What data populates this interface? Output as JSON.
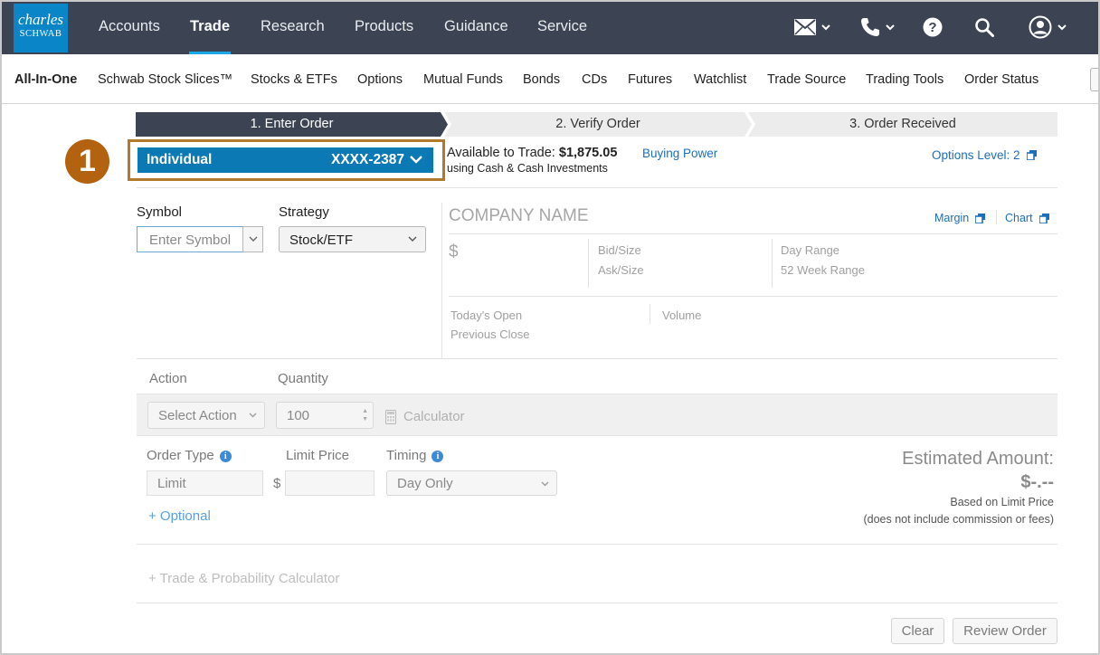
{
  "brand": {
    "logo_line1": "charles",
    "logo_line2": "SCHWAB",
    "logo_color": "#0a86c8"
  },
  "topnav": {
    "items": [
      {
        "label": "Accounts"
      },
      {
        "label": "Trade",
        "active": true
      },
      {
        "label": "Research"
      },
      {
        "label": "Products"
      },
      {
        "label": "Guidance"
      },
      {
        "label": "Service"
      }
    ],
    "icons": [
      "mail-icon",
      "phone-icon",
      "help-icon",
      "search-icon",
      "user-icon"
    ],
    "background": "#3c4453",
    "active_underline": "#19a9e8"
  },
  "subnav": {
    "items": [
      {
        "label": "All-In-One",
        "active": true
      },
      {
        "label": "Schwab Stock Slices™"
      },
      {
        "label": "Stocks & ETFs"
      },
      {
        "label": "Options"
      },
      {
        "label": "Mutual Funds"
      },
      {
        "label": "Bonds"
      },
      {
        "label": "CDs"
      },
      {
        "label": "Futures"
      },
      {
        "label": "Watchlist"
      },
      {
        "label": "Trade Source"
      },
      {
        "label": "Trading Tools"
      },
      {
        "label": "Order Status"
      }
    ]
  },
  "steps": [
    {
      "label": "1. Enter Order",
      "active": true
    },
    {
      "label": "2. Verify Order"
    },
    {
      "label": "3. Order Received"
    }
  ],
  "callout": {
    "number": "1",
    "color": "#b3620f"
  },
  "account": {
    "name": "Individual",
    "number": "XXXX-2387",
    "available_label": "Available to Trade:",
    "available_value": "$1,875.05",
    "available_sub": "using Cash & Cash Investments",
    "buying_power": "Buying Power",
    "options_level": "Options Level: 2"
  },
  "order_entry": {
    "symbol_label": "Symbol",
    "symbol_placeholder": "Enter Symbol",
    "strategy_label": "Strategy",
    "strategy_value": "Stock/ETF"
  },
  "quote": {
    "company": "COMPANY NAME",
    "margin_link": "Margin",
    "chart_link": "Chart",
    "price": "$",
    "bid_size": "Bid/Size",
    "ask_size": "Ask/Size",
    "day_range": "Day Range",
    "week52_range": "52 Week Range",
    "todays_open": "Today's Open",
    "previous_close": "Previous Close",
    "volume": "Volume"
  },
  "action": {
    "action_label": "Action",
    "quantity_label": "Quantity",
    "action_value": "Select Action",
    "quantity_value": "100",
    "calculator": "Calculator"
  },
  "order": {
    "order_type_label": "Order Type",
    "order_type_value": "Limit",
    "limit_price_label": "Limit Price",
    "limit_dollar": "$",
    "timing_label": "Timing",
    "timing_value": "Day Only",
    "optional": "+  Optional",
    "estimated_label": "Estimated Amount:",
    "estimated_value": "$-.--",
    "estimated_note1": "Based on Limit Price",
    "estimated_note2": "(does not include commission or fees)"
  },
  "trade_prob": "+ Trade & Probability Calculator",
  "buttons": {
    "clear": "Clear",
    "review": "Review Order"
  }
}
